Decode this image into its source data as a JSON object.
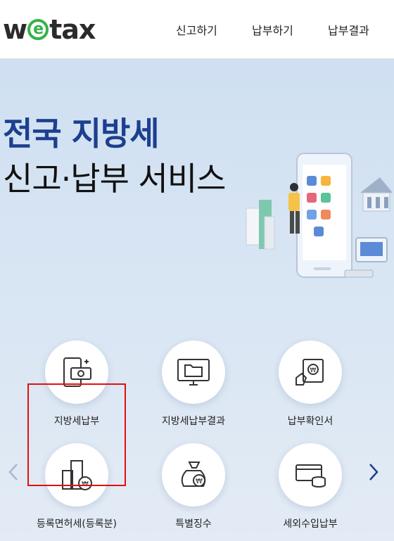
{
  "header": {
    "logo": {
      "w": "w",
      "e": "e",
      "tax": "tax"
    },
    "nav": [
      "신고하기",
      "납부하기",
      "납부결과"
    ]
  },
  "hero": {
    "title_line1": "전국 지방세",
    "title_line2": "신고·납부 서비스"
  },
  "menu": [
    {
      "label": "지방세납부",
      "icon": "card-payment-icon",
      "selected": true
    },
    {
      "label": "지방세납부결과",
      "icon": "monitor-folder-icon"
    },
    {
      "label": "납부확인서",
      "icon": "receipt-hand-icon"
    },
    {
      "label": "등록면허세(등록분)",
      "icon": "building-coin-icon"
    },
    {
      "label": "특별징수",
      "icon": "money-bag-icon"
    },
    {
      "label": "세외수입납부",
      "icon": "card-coins-icon"
    }
  ],
  "colors": {
    "accent": "#1d3f8f",
    "logo_e": "#36b24a",
    "highlight": "#e30f0f"
  },
  "carousel": {
    "prev_icon": "chevron-left-icon",
    "next_icon": "chevron-right-icon"
  }
}
